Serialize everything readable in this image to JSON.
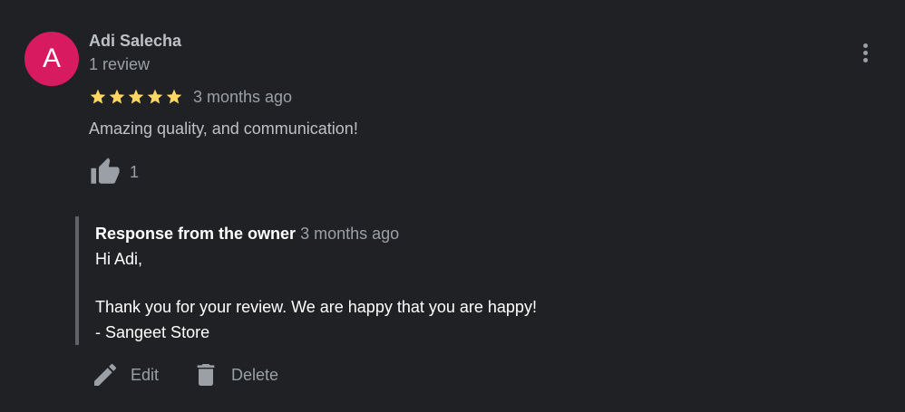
{
  "reviewer": {
    "avatar_letter": "A",
    "avatar_color": "#d81b60",
    "name": "Adi Salecha",
    "meta": "1 review"
  },
  "rating": {
    "stars": 5,
    "star_color": "#fdd663",
    "date": "3 months ago"
  },
  "review_text": "Amazing quality, and communication!",
  "likes": {
    "icon": "thumbs-up-icon",
    "count": "1"
  },
  "owner_response": {
    "label": "Response from the owner",
    "date": "3 months ago",
    "lines": [
      "Hi Adi,",
      "",
      "Thank you for your review. We are happy that you are happy!",
      "- Sangeet Store"
    ]
  },
  "actions": {
    "edit_label": "Edit",
    "delete_label": "Delete"
  },
  "menu": {
    "icon": "more-vert-icon"
  }
}
